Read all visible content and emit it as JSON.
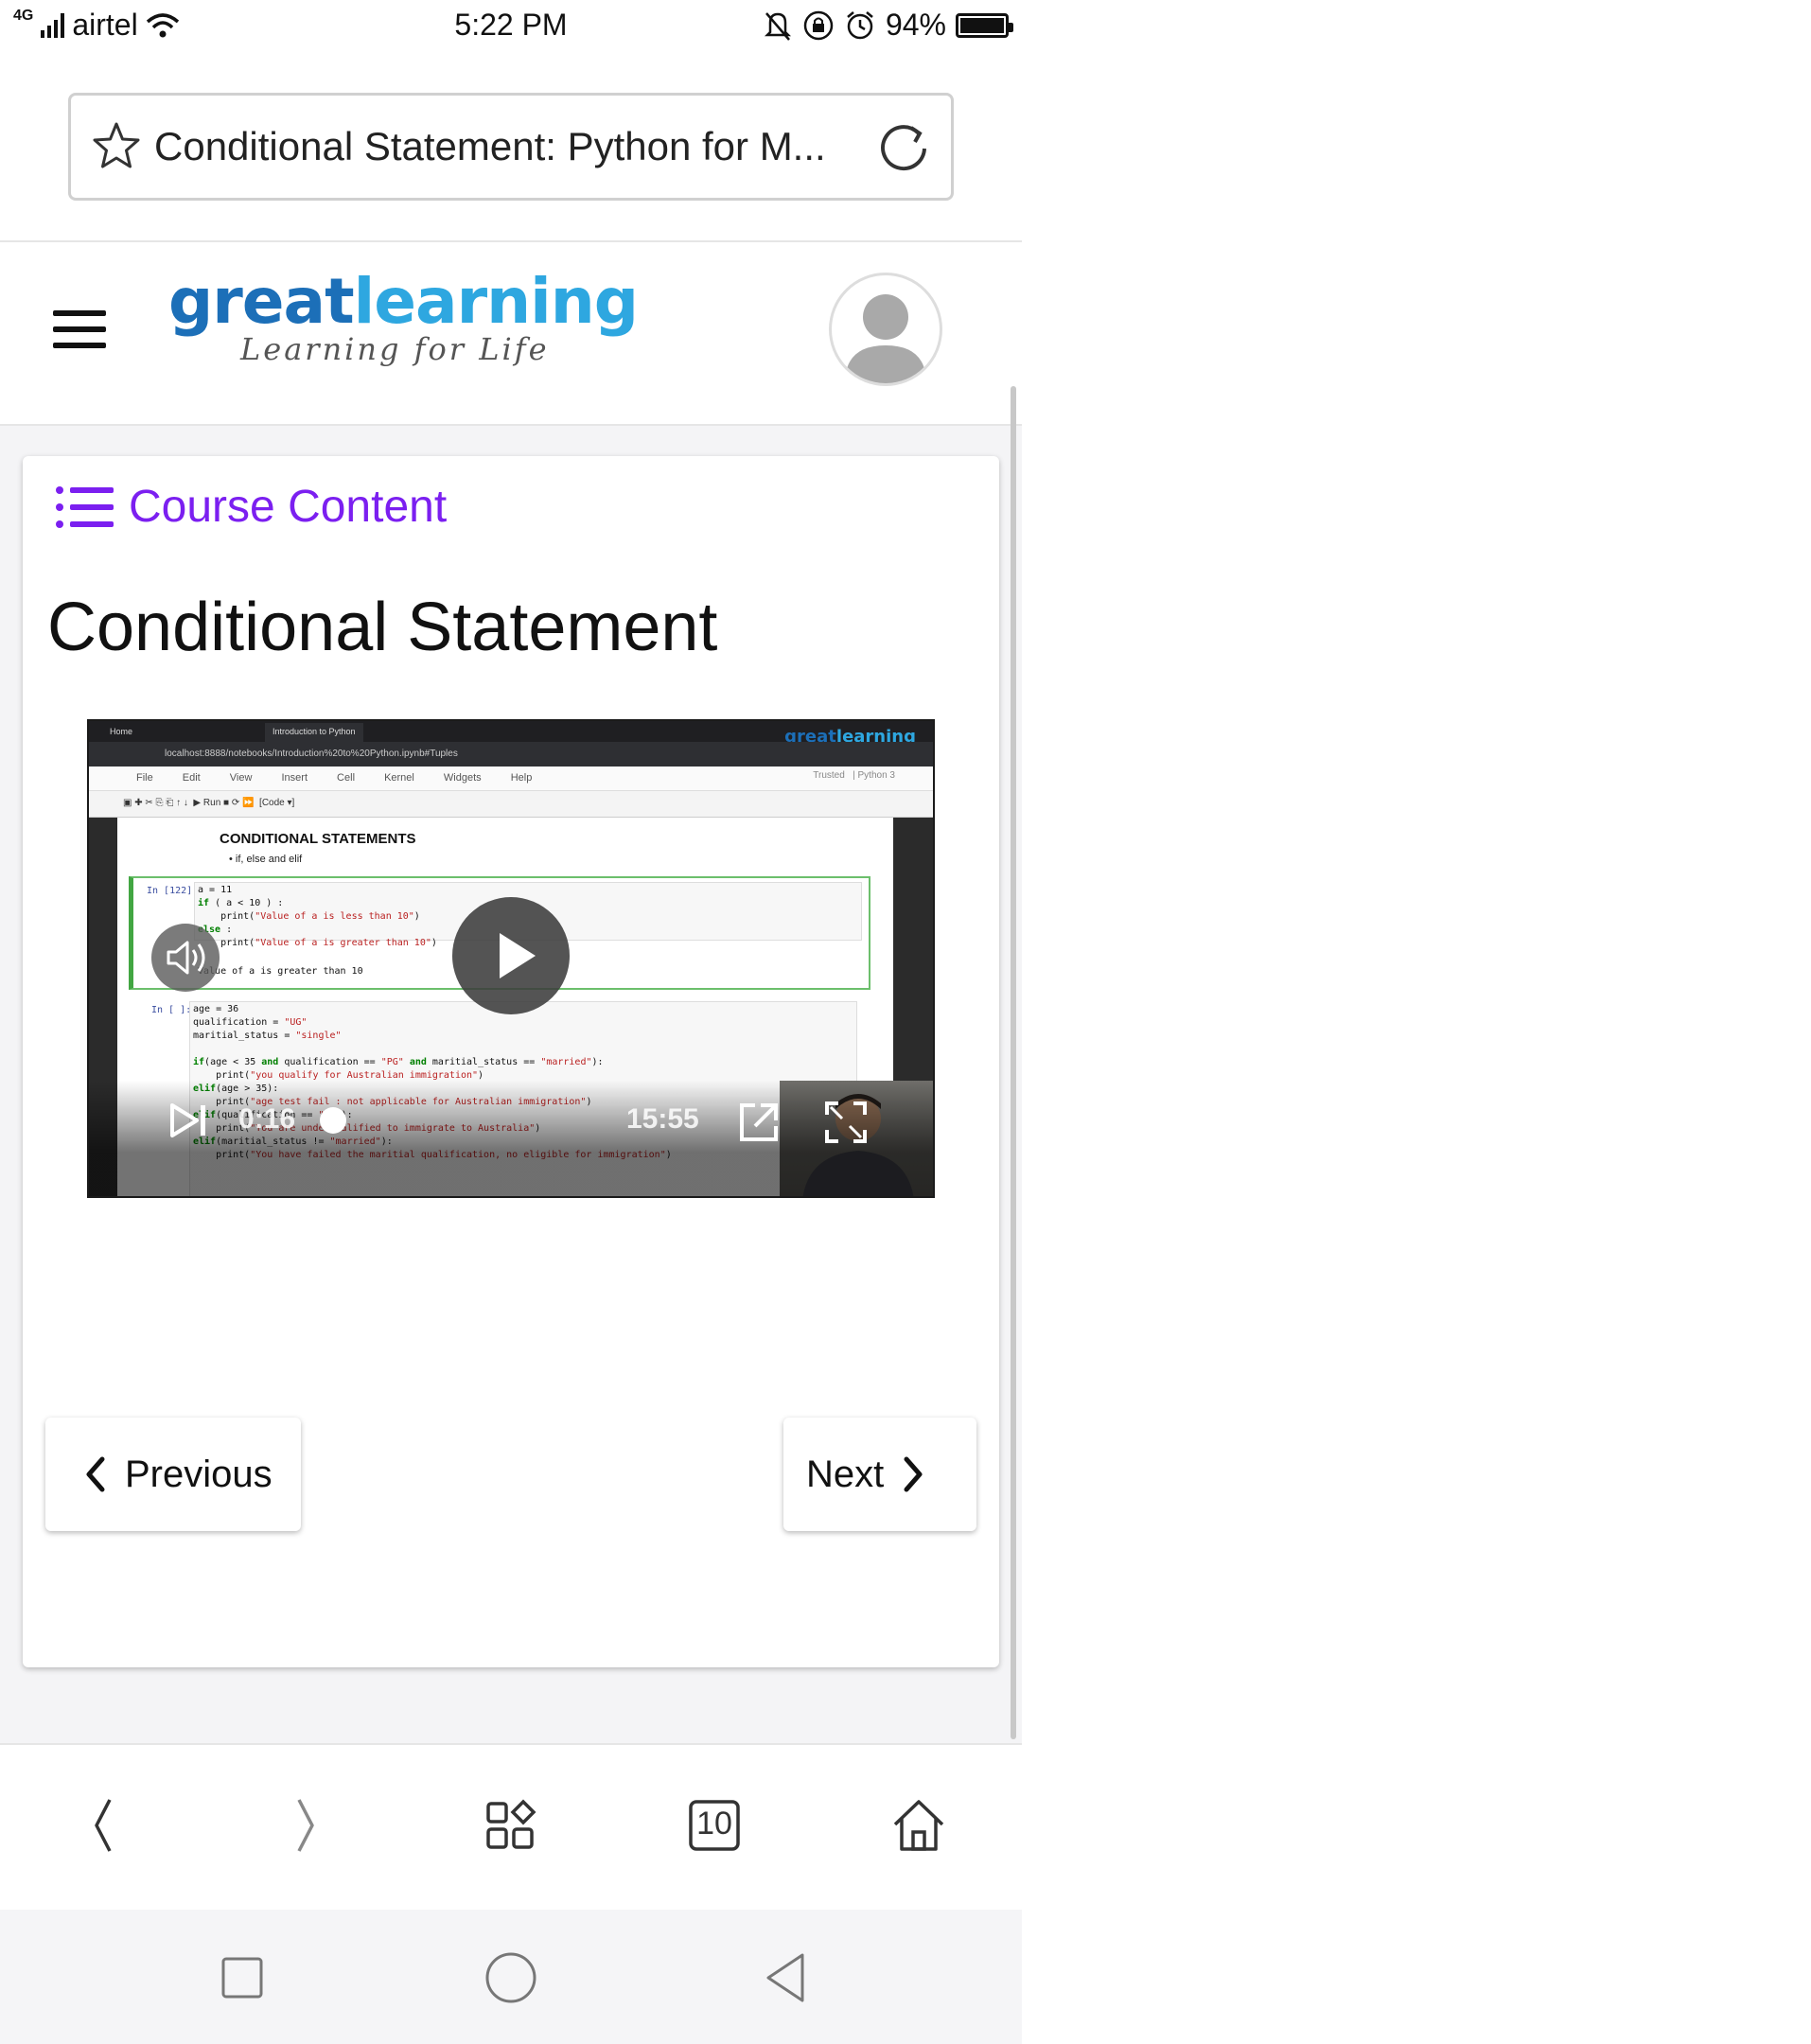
{
  "status_bar": {
    "network": "4G",
    "carrier": "airtel",
    "time": "5:22 PM",
    "battery": "94%"
  },
  "browser": {
    "url_title": "Conditional Statement: Python for M...",
    "tab_count": "10"
  },
  "site": {
    "logo_word_1": "great",
    "logo_word_2": "learning",
    "logo_tagline": "Learning for Life"
  },
  "course": {
    "course_content_label": "Course Content",
    "lesson_title": "Conditional Statement"
  },
  "video": {
    "tab_home": "Home",
    "tab_notebook": "Introduction to Python",
    "address": "localhost:8888/notebooks/Introduction%20to%20Python.ipynb#Tuples",
    "menu": "File Edit View Insert Cell Kernel Widgets Help",
    "trusted": "Trusted",
    "kernel": "Python 3",
    "toolbar_run": "Run",
    "toolbar_celltype": "Code",
    "heading": "CONDITIONAL STATEMENTS",
    "bullet": "if, else and elif",
    "cell1_prompt": "In [122]:",
    "cell1_output": "Value of a is greater than 10",
    "cell2_prompt": "In [ ]:",
    "current_time": "0:16",
    "duration": "15:55"
  },
  "navigation": {
    "previous_label": "Previous",
    "next_label": "Next"
  },
  "colors": {
    "accent_purple": "#7b1ff0",
    "logo_dark_blue": "#1c6fb8",
    "logo_light_blue": "#2ea7e0"
  },
  "icons": [
    "star-icon",
    "reload-icon",
    "hamburger-icon",
    "avatar-icon",
    "list-icon",
    "play-icon",
    "volume-icon",
    "skip-next-icon",
    "popout-icon",
    "fullscreen-icon",
    "chevron-left-icon",
    "chevron-right-icon",
    "back-icon",
    "forward-icon",
    "apps-icon",
    "tabs-icon",
    "home-icon",
    "recents-icon",
    "android-home-icon",
    "android-back-icon"
  ]
}
